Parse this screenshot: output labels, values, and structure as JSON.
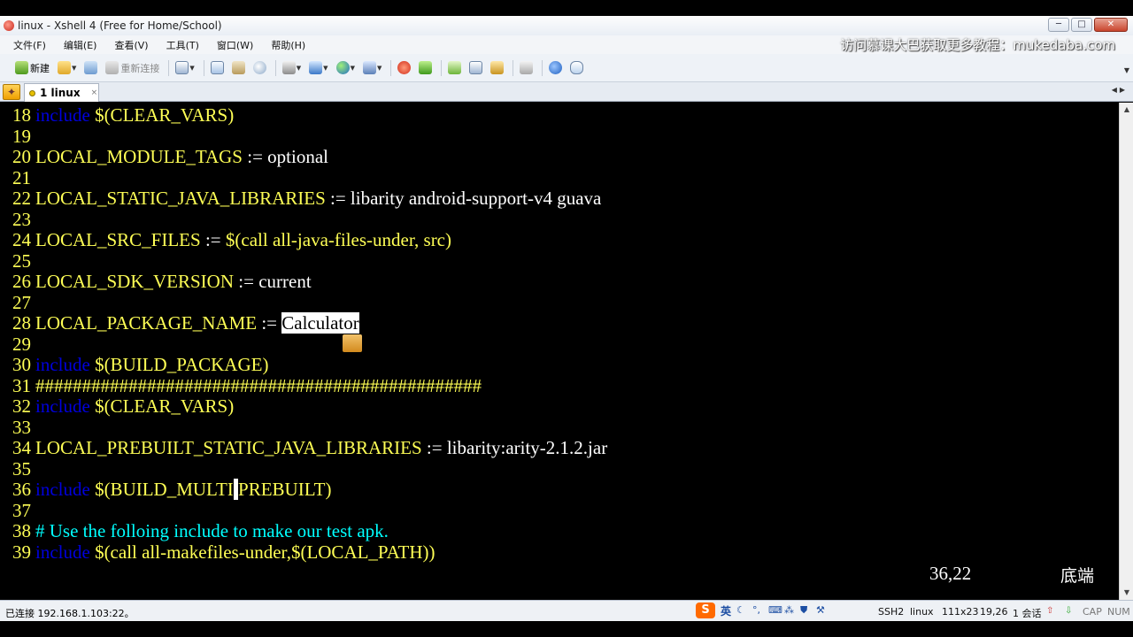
{
  "window": {
    "title": "linux - Xshell 4 (Free for Home/School)",
    "controls": {
      "minimize": "─",
      "maximize": "□",
      "close": "✕"
    }
  },
  "menu": {
    "items": [
      "文件(F)",
      "编辑(E)",
      "查看(V)",
      "工具(T)",
      "窗口(W)",
      "帮助(H)"
    ],
    "watermark": "访问慕课大巴获取更多教程：mukedaba.com"
  },
  "toolbar": {
    "new_label": "新建",
    "reconnect_label": "重新连接"
  },
  "tabs": {
    "nav_icon": "✦",
    "items": [
      {
        "label": "1 linux",
        "close": "×"
      }
    ]
  },
  "terminal": {
    "lines": [
      {
        "num": "18",
        "segments": [
          [
            "inc",
            "include"
          ],
          [
            "var",
            " $(CLEAR_VARS)"
          ]
        ]
      },
      {
        "num": "19",
        "segments": []
      },
      {
        "num": "20",
        "segments": [
          [
            "var",
            "LOCAL_MODULE_TAGS"
          ],
          [
            "txt",
            " := optional"
          ]
        ]
      },
      {
        "num": "21",
        "segments": []
      },
      {
        "num": "22",
        "segments": [
          [
            "var",
            "LOCAL_STATIC_JAVA_LIBRARIES"
          ],
          [
            "txt",
            " := libarity android-support-v4 guava"
          ]
        ]
      },
      {
        "num": "23",
        "segments": []
      },
      {
        "num": "24",
        "segments": [
          [
            "var",
            "LOCAL_SRC_FILES"
          ],
          [
            "txt",
            " := "
          ],
          [
            "var",
            "$(call all-java-files-under, src)"
          ]
        ]
      },
      {
        "num": "25",
        "segments": []
      },
      {
        "num": "26",
        "segments": [
          [
            "var",
            "LOCAL_SDK_VERSION"
          ],
          [
            "txt",
            " := current"
          ]
        ]
      },
      {
        "num": "27",
        "segments": []
      },
      {
        "num": "28",
        "segments": [
          [
            "var",
            "LOCAL_PACKAGE_NAME"
          ],
          [
            "txt",
            " := "
          ],
          [
            "hl",
            "Calculator"
          ]
        ]
      },
      {
        "num": "29",
        "segments": []
      },
      {
        "num": "30",
        "segments": [
          [
            "inc",
            "include"
          ],
          [
            "var",
            " $(BUILD_PACKAGE)"
          ]
        ]
      },
      {
        "num": "31",
        "segments": [
          [
            "var",
            "################################################"
          ]
        ]
      },
      {
        "num": "32",
        "segments": [
          [
            "inc",
            "include"
          ],
          [
            "var",
            " $(CLEAR_VARS)"
          ]
        ]
      },
      {
        "num": "33",
        "segments": []
      },
      {
        "num": "34",
        "segments": [
          [
            "var",
            "LOCAL_PREBUILT_STATIC_JAVA_LIBRARIES"
          ],
          [
            "txt",
            " := libarity:arity-2.1.2.jar"
          ]
        ]
      },
      {
        "num": "35",
        "segments": []
      },
      {
        "num": "36",
        "segments": [
          [
            "inc",
            "include"
          ],
          [
            "var",
            " $(BUILD_MULTI"
          ],
          [
            "cur",
            "_"
          ],
          [
            "var",
            "PREBUILT)"
          ]
        ]
      },
      {
        "num": "37",
        "segments": []
      },
      {
        "num": "38",
        "segments": [
          [
            "cmt",
            "# Use the folloing include to make our test apk."
          ]
        ]
      },
      {
        "num": "39",
        "segments": [
          [
            "inc",
            "include"
          ],
          [
            "var",
            " $(call all-makefiles-under,$(LOCAL_PATH))"
          ]
        ]
      }
    ],
    "cursor_pos": "36,22",
    "position_label": "底端"
  },
  "statusbar": {
    "connection": "已连接 192.168.1.103:22。",
    "ime_logo": "S",
    "ime_lang": "英",
    "protocol": "SSH2",
    "terminal_type": "linux",
    "size": "111x23",
    "cursor": "19,26",
    "sessions": "1 会话",
    "cap": "CAP",
    "num": "NUM"
  },
  "colors": {
    "include_keyword": "#0000dd",
    "variable": "#ffff55",
    "comment": "#00ffff",
    "text": "#ffffff"
  }
}
